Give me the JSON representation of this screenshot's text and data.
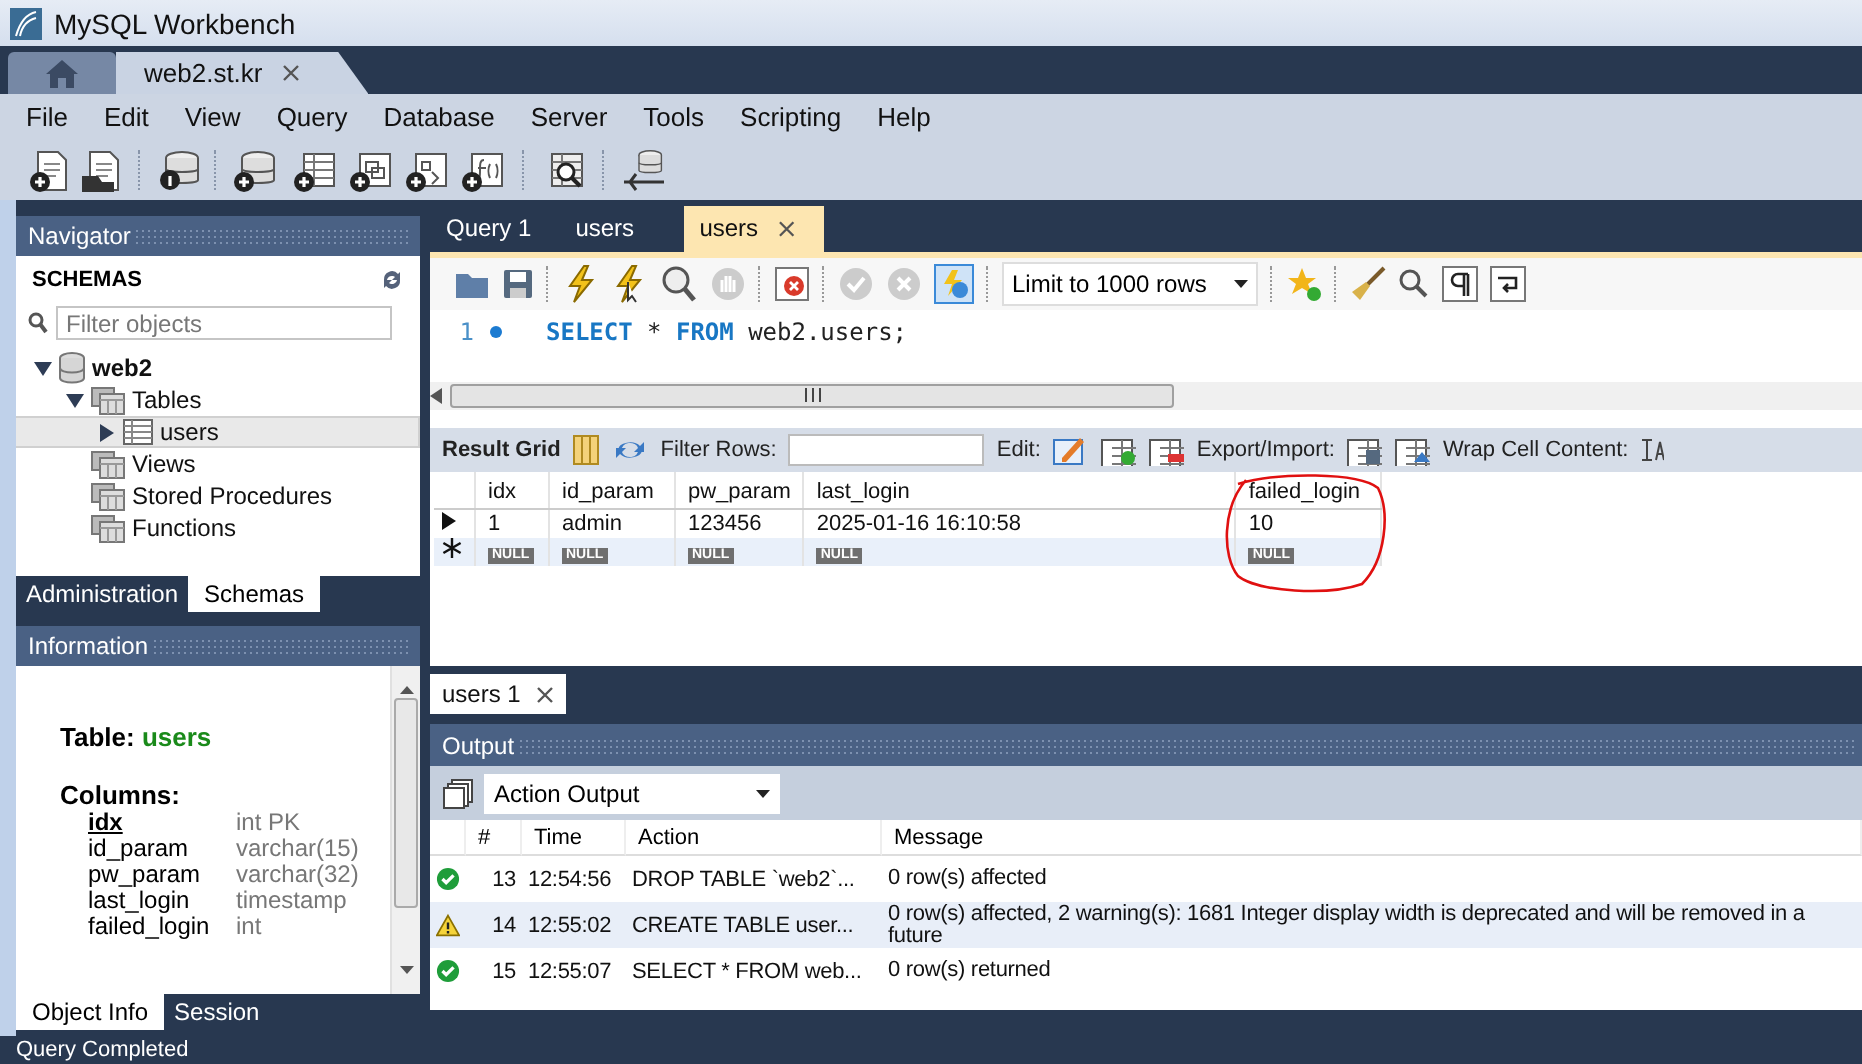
{
  "window": {
    "title": "MySQL Workbench"
  },
  "connection_tabs": [
    {
      "kind": "home",
      "selected": false
    },
    {
      "kind": "connection",
      "label": "web2.st.kr",
      "selected": true
    }
  ],
  "menu": [
    "File",
    "Edit",
    "View",
    "Query",
    "Database",
    "Server",
    "Tools",
    "Scripting",
    "Help"
  ],
  "navigator": {
    "title": "Navigator",
    "section": "SCHEMAS",
    "filter": {
      "placeholder": "Filter objects"
    },
    "tree": [
      {
        "kind": "schema",
        "label": "web2",
        "expanded": true,
        "selected": false,
        "children": [
          {
            "kind": "group",
            "label": "Tables",
            "expanded": true,
            "selected": false,
            "children": [
              {
                "kind": "table",
                "label": "users",
                "expanded": false,
                "selected": true
              }
            ]
          },
          {
            "kind": "group",
            "label": "Views",
            "selected": false
          },
          {
            "kind": "group",
            "label": "Stored Procedures",
            "selected": false
          },
          {
            "kind": "group",
            "label": "Functions",
            "selected": false
          }
        ]
      }
    ],
    "tabs": [
      {
        "label": "Administration",
        "selected": false
      },
      {
        "label": "Schemas",
        "selected": true
      }
    ]
  },
  "information": {
    "title": "Information",
    "table_label": "Table:",
    "table_name": "users",
    "columns_label": "Columns:",
    "columns": [
      {
        "name": "idx",
        "type": "int PK",
        "primary": true
      },
      {
        "name": "id_param",
        "type": "varchar(15)",
        "primary": false
      },
      {
        "name": "pw_param",
        "type": "varchar(32)",
        "primary": false
      },
      {
        "name": "last_login",
        "type": "timestamp",
        "primary": false
      },
      {
        "name": "failed_login",
        "type": "int",
        "primary": false
      }
    ],
    "tabs": [
      {
        "label": "Object Info",
        "selected": true
      },
      {
        "label": "Session",
        "selected": false
      }
    ]
  },
  "editor": {
    "tabs": [
      {
        "label": "Query 1",
        "selected": false
      },
      {
        "label": "users",
        "selected": false
      },
      {
        "label": "users",
        "selected": true
      }
    ],
    "limit": "Limit to 1000 rows",
    "lines": [
      {
        "number": "1",
        "tokens": [
          {
            "kind": "keyword",
            "text": "SELECT"
          },
          {
            "kind": "plain",
            "text": "*"
          },
          {
            "kind": "keyword",
            "text": "FROM"
          },
          {
            "kind": "plain",
            "text": "web2.users;"
          }
        ]
      }
    ]
  },
  "result": {
    "grid_label": "Result Grid",
    "filter_label": "Filter Rows:",
    "edit_label": "Edit:",
    "export_label": "Export/Import:",
    "wrap_label": "Wrap Cell Content:",
    "columns": [
      "idx",
      "id_param",
      "pw_param",
      "last_login",
      "failed_login"
    ],
    "rows": [
      {
        "kind": "current",
        "cells": [
          {
            "kind": "value",
            "text": "1"
          },
          {
            "kind": "value",
            "text": "admin"
          },
          {
            "kind": "value",
            "text": "123456"
          },
          {
            "kind": "value",
            "text": "2025-01-16 16:10:58"
          },
          {
            "kind": "value",
            "text": "10"
          }
        ]
      },
      {
        "kind": "new",
        "cells": [
          {
            "kind": "null",
            "text": "NULL"
          },
          {
            "kind": "null",
            "text": "NULL"
          },
          {
            "kind": "null",
            "text": "NULL"
          },
          {
            "kind": "null",
            "text": "NULL"
          },
          {
            "kind": "null",
            "text": "NULL"
          }
        ]
      }
    ],
    "tabs": [
      {
        "label": "users 1",
        "selected": true
      }
    ]
  },
  "output": {
    "title": "Output",
    "mode": "Action Output",
    "columns": [
      "#",
      "Time",
      "Action",
      "Message"
    ],
    "rows": [
      {
        "kind": "ok",
        "number": "13",
        "time": "12:54:56",
        "action": "DROP TABLE `web2`...",
        "message": "0 row(s) affected"
      },
      {
        "kind": "warning",
        "number": "14",
        "time": "12:55:02",
        "action": "CREATE TABLE user...",
        "message": "0 row(s) affected, 2 warning(s): 1681 Integer display width is deprecated and will be removed in a future"
      },
      {
        "kind": "ok",
        "number": "15",
        "time": "12:55:07",
        "action": "SELECT * FROM web...",
        "message": "0 row(s) returned"
      }
    ]
  },
  "status_bar": "Query Completed"
}
